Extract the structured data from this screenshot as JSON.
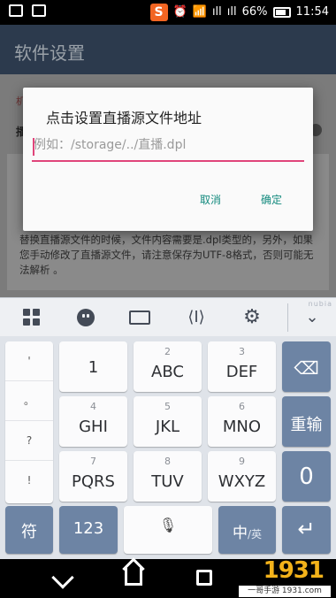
{
  "status_bar": {
    "sogou_label": "S",
    "signal1_label": "ıll",
    "signal2_label": "ıll",
    "battery_label": "66%",
    "time": "11:54",
    "icons": [
      "image-icon",
      "sogou-icon",
      "alarm-icon",
      "wifi-icon",
      "signal-icon",
      "battery-icon"
    ]
  },
  "app": {
    "title": "软件设置",
    "hint_top": "机",
    "hint_second": "播",
    "body_text": "替换直播源文件的时候，文件内容需要是.dpl类型的，另外，如果您手动修改了直播源文件，请注意保存为UTF-8格式，否则可能无法解析 。"
  },
  "dialog": {
    "title": "点击设置直播源文件地址",
    "input_placeholder": "例如：/storage/../直播.dpl",
    "input_value": "",
    "cancel_label": "取消",
    "ok_label": "确定",
    "accent": "#e0447a",
    "button_color": "#138a7e"
  },
  "keyboard": {
    "toolbar": {
      "brand": "nubia",
      "icons": [
        "grid-icon",
        "emoji-icon",
        "keyboard-icon",
        "cursor-move-icon",
        "settings-icon",
        "collapse-icon"
      ],
      "cursor_glyph": "⟨I⟩",
      "gear_glyph": "⚙",
      "collapse_glyph": "⌄"
    },
    "side_symbols": [
      "'",
      "。",
      "?",
      "!"
    ],
    "rows": [
      [
        {
          "big": "1",
          "small": ""
        },
        {
          "big": "ABC",
          "small": "2"
        },
        {
          "big": "DEF",
          "small": "3"
        }
      ],
      [
        {
          "big": "GHI",
          "small": "4"
        },
        {
          "big": "JKL",
          "small": "5"
        },
        {
          "big": "MNO",
          "small": "6"
        }
      ],
      [
        {
          "big": "PQRS",
          "small": "7"
        },
        {
          "big": "TUV",
          "small": "8"
        },
        {
          "big": "WXYZ",
          "small": "9"
        }
      ]
    ],
    "backspace_glyph": "⌫",
    "rewrite_label": "重输",
    "zero_label": "0",
    "symbol_label": "符",
    "num_label": "123",
    "space_glyph": "🎙",
    "lang_label_main": "中",
    "lang_label_alt": "/英",
    "enter_glyph": "↵",
    "key_color": "#fbfbfc",
    "dark_key_color": "#6d84a4"
  },
  "watermark": {
    "logo": "1931",
    "caption": "一哥手游 1931.com"
  }
}
